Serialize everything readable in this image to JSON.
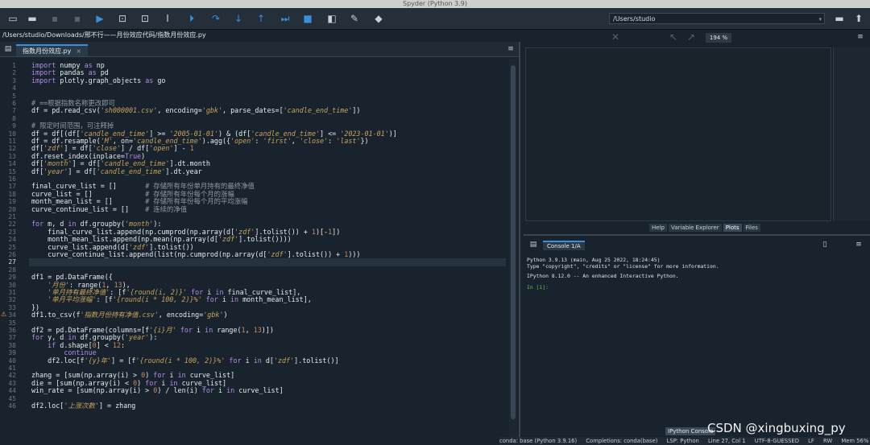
{
  "window": {
    "title": "Spyder (Python 3.9)"
  },
  "toolbar": {
    "working_dir": "/Users/studio"
  },
  "editor": {
    "path": "/Users/studio/Downloads/邢不行——月份效应代码/指数月份效应.py",
    "tab_label": "指数月份效应.py",
    "lines": [
      {
        "n": "1",
        "html": "<span class=\"kw\">import</span> numpy <span class=\"kw\">as</span> np"
      },
      {
        "n": "2",
        "html": "<span class=\"kw\">import</span> pandas <span class=\"kw\">as</span> pd"
      },
      {
        "n": "3",
        "html": "<span class=\"kw\">import</span> plotly.graph_objects <span class=\"kw\">as</span> go"
      },
      {
        "n": "4",
        "html": ""
      },
      {
        "n": "5",
        "html": ""
      },
      {
        "n": "6",
        "html": "<span class=\"cm\"># ==根据指数名称更改即可</span>"
      },
      {
        "n": "7",
        "html": "df = pd.read_csv(<span class=\"str\">'sh000001.csv'</span>, encoding=<span class=\"str\">'gbk'</span>, parse_dates=[<span class=\"str\">'candle_end_time'</span>])"
      },
      {
        "n": "8",
        "html": ""
      },
      {
        "n": "9",
        "html": "<span class=\"cm\"># 限定时间范围，可注释掉</span>"
      },
      {
        "n": "10",
        "html": "df = df[(df[<span class=\"str\">'candle_end_time'</span>] &gt;= <span class=\"str\">'2005-01-01'</span>) &amp; (df[<span class=\"str\">'candle_end_time'</span>] &lt;= <span class=\"str\">'2023-01-01'</span>)]"
      },
      {
        "n": "11",
        "html": "df = df.resample(<span class=\"str\">'M'</span>, on=<span class=\"str\">'candle_end_time'</span>).agg({<span class=\"str\">'open'</span>: <span class=\"str\">'first'</span>, <span class=\"str\">'close'</span>: <span class=\"str\">'last'</span>})"
      },
      {
        "n": "12",
        "html": "df[<span class=\"str\">'zdf'</span>] = df[<span class=\"str\">'close'</span>] / df[<span class=\"str\">'open'</span>] - <span class=\"num\">1</span>"
      },
      {
        "n": "13",
        "html": "df.reset_index(inplace=<span class=\"kw\">True</span>)"
      },
      {
        "n": "14",
        "html": "df[<span class=\"str\">'month'</span>] = df[<span class=\"str\">'candle_end_time'</span>].dt.month"
      },
      {
        "n": "15",
        "html": "df[<span class=\"str\">'year'</span>] = df[<span class=\"str\">'candle_end_time'</span>].dt.year"
      },
      {
        "n": "16",
        "html": ""
      },
      {
        "n": "17",
        "html": "final_curve_list = []       <span class=\"cm\"># 存储所有年份单月持有的最终净值</span>"
      },
      {
        "n": "18",
        "html": "curve_list = []             <span class=\"cm\"># 存储所有年份每个月的涨幅</span>"
      },
      {
        "n": "19",
        "html": "month_mean_list = []        <span class=\"cm\"># 存储所有年份每个月的平均涨幅</span>"
      },
      {
        "n": "20",
        "html": "curve_continue_list = []    <span class=\"cm\"># 连续的净值</span>"
      },
      {
        "n": "21",
        "html": ""
      },
      {
        "n": "22",
        "html": "<span class=\"kw\">for</span> m, d <span class=\"kw\">in</span> df.groupby(<span class=\"str\">'month'</span>):"
      },
      {
        "n": "23",
        "html": "    final_curve_list.append(np.cumprod(np.array(d[<span class=\"str\">'zdf'</span>].tolist()) + <span class=\"num\">1</span>)[-<span class=\"num\">1</span>])"
      },
      {
        "n": "24",
        "html": "    month_mean_list.append(np.mean(np.array(d[<span class=\"str\">'zdf'</span>].tolist())))"
      },
      {
        "n": "25",
        "html": "    curve_list.append(d[<span class=\"str\">'zdf'</span>].tolist())"
      },
      {
        "n": "26",
        "html": "    curve_continue_list.append(list(np.cumprod(np.array(d[<span class=\"str\">'zdf'</span>].tolist()) + <span class=\"num\">1</span>)))"
      },
      {
        "n": "27",
        "html": ""
      },
      {
        "n": "28",
        "html": ""
      },
      {
        "n": "29",
        "html": "df1 = pd.DataFrame({"
      },
      {
        "n": "30",
        "html": "    <span class=\"str\">'月份'</span>: range(<span class=\"num\">1</span>, <span class=\"num\">13</span>),"
      },
      {
        "n": "31",
        "html": "    <span class=\"str\">'单月持有最终净值'</span>: [f<span class=\"str\">'{round(i, 2)}'</span> <span class=\"kw\">for</span> i <span class=\"kw\">in</span> final_curve_list],"
      },
      {
        "n": "32",
        "html": "    <span class=\"str\">'单月平均涨幅'</span>: [f<span class=\"str\">'{round(i * 100, 2)}%'</span> <span class=\"kw\">for</span> i <span class=\"kw\">in</span> month_mean_list],"
      },
      {
        "n": "33",
        "html": "})"
      },
      {
        "n": "34",
        "html": "df1.to_csv(f<span class=\"str\">'指数月份持有净值.csv'</span>, encoding=<span class=\"str\">'gbk'</span>)"
      },
      {
        "n": "35",
        "html": ""
      },
      {
        "n": "36",
        "html": "df2 = pd.DataFrame(columns=[f<span class=\"str\">'{i}月'</span> <span class=\"kw\">for</span> i <span class=\"kw\">in</span> range(<span class=\"num\">1</span>, <span class=\"num\">13</span>)])"
      },
      {
        "n": "37",
        "html": "<span class=\"kw\">for</span> y, d <span class=\"kw\">in</span> df.groupby(<span class=\"str\">'year'</span>):"
      },
      {
        "n": "38",
        "html": "    <span class=\"kw\">if</span> d.shape[<span class=\"num\">0</span>] &lt; <span class=\"num\">12</span>:"
      },
      {
        "n": "39",
        "html": "        <span class=\"kw\">continue</span>"
      },
      {
        "n": "40",
        "html": "    df2.loc[f<span class=\"str\">'{y}年'</span>] = [f<span class=\"str\">'{round(i * 100, 2)}%'</span> <span class=\"kw\">for</span> i <span class=\"kw\">in</span> d[<span class=\"str\">'zdf'</span>].tolist()]"
      },
      {
        "n": "41",
        "html": ""
      },
      {
        "n": "42",
        "html": "zhang = [sum(np.array(i) &gt; <span class=\"num\">0</span>) <span class=\"kw\">for</span> i <span class=\"kw\">in</span> curve_list]"
      },
      {
        "n": "43",
        "html": "die = [sum(np.array(i) &lt; <span class=\"num\">0</span>) <span class=\"kw\">for</span> i <span class=\"kw\">in</span> curve_list]"
      },
      {
        "n": "44",
        "html": "win_rate = [sum(np.array(i) &gt; <span class=\"num\">0</span>) / len(i) <span class=\"kw\">for</span> i <span class=\"kw\">in</span> curve_list]"
      },
      {
        "n": "45",
        "html": ""
      },
      {
        "n": "46",
        "html": "df2.loc[<span class=\"str\">'上涨次数'</span>] = zhang"
      }
    ]
  },
  "plots": {
    "zoom": "194 %",
    "tabs": [
      "Help",
      "Variable Explorer",
      "Plots",
      "Files"
    ]
  },
  "console": {
    "tab_label": "Console 1/A",
    "lines": [
      "Python 3.9.13 (main, Aug 25 2022, 18:24:45)",
      "Type \"copyright\", \"credits\" or \"license\" for more information.",
      "",
      "IPython 8.12.0 -- An enhanced Interactive Python.",
      "",
      "In [1]:"
    ],
    "bottom_tab": "IPython Console"
  },
  "statusbar": {
    "env": "conda: base (Python 3.9.16)",
    "completions": "Completions: conda(base)",
    "lsp": "LSP: Python",
    "position": "Line 27, Col 1",
    "encoding": "UTF-8-GUESSED",
    "eol": "LF",
    "rw": "RW",
    "mem": "Mem 56%"
  },
  "watermark": "CSDN @xingbuxing_py"
}
